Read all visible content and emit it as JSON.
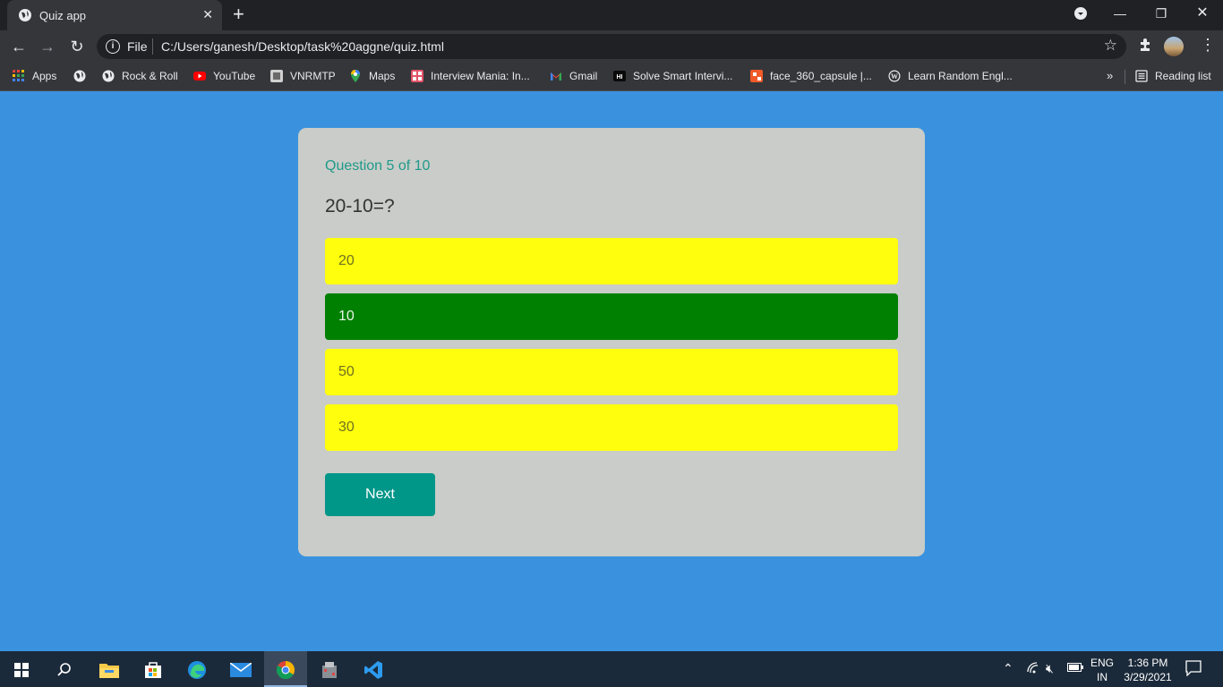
{
  "browser": {
    "tab_title": "Quiz app",
    "tab_close": "✕",
    "new_tab": "+",
    "scheme_label": "File",
    "url": "C:/Users/ganesh/Desktop/task%20aggne/quiz.html",
    "bookmarks": [
      {
        "label": "Apps",
        "icon": "apps-grid-icon"
      },
      {
        "label": "",
        "icon": "globe-icon"
      },
      {
        "label": "Rock & Roll",
        "icon": "globe-icon"
      },
      {
        "label": "YouTube",
        "icon": "youtube-icon"
      },
      {
        "label": "VNRMTP",
        "icon": "vnrmtp-icon"
      },
      {
        "label": "Maps",
        "icon": "maps-pin-icon"
      },
      {
        "label": "Interview Mania: In...",
        "icon": "interview-mania-icon"
      },
      {
        "label": "Gmail",
        "icon": "gmail-icon"
      },
      {
        "label": "Solve Smart Intervi...",
        "icon": "solve-smart-icon"
      },
      {
        "label": "face_360_capsule |...",
        "icon": "face-capsule-icon"
      },
      {
        "label": "Learn Random Engl...",
        "icon": "wordpress-icon"
      }
    ],
    "more_bookmarks": "»",
    "reading_list": "Reading list"
  },
  "quiz": {
    "counter": "Question 5 of 10",
    "question": "20-10=?",
    "options": [
      "20",
      "10",
      "50",
      "30"
    ],
    "correct_index": 1,
    "next_label": "Next",
    "colors": {
      "background": "#3a92df",
      "card": "#c9ccc8",
      "option": "#ffff0d",
      "correct": "#008000",
      "accent": "#009688"
    }
  },
  "taskbar": {
    "lang_top": "ENG",
    "lang_bottom": "IN",
    "time": "1:36 PM",
    "date": "3/29/2021"
  }
}
